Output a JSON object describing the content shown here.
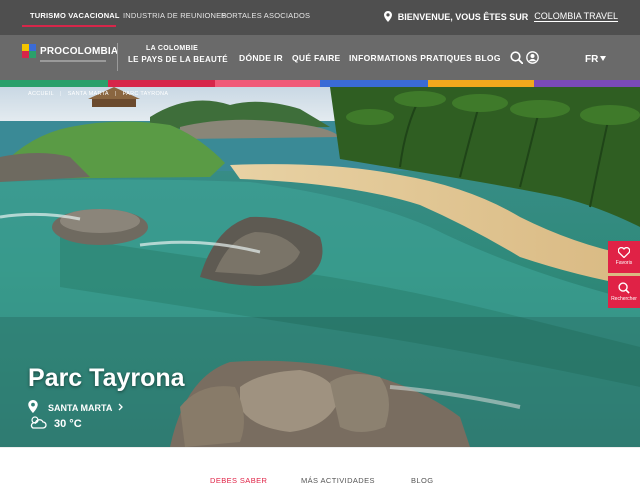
{
  "topbar": {
    "links": [
      {
        "label": "TURISMO VACACIONAL",
        "active": true
      },
      {
        "label": "INDUSTRIA DE REUNIONES",
        "active": false
      },
      {
        "label": "PORTALES ASOCIADOS",
        "active": false
      }
    ],
    "welcome_prefix": "BIENVENUE, VOUS ÊTES SUR",
    "welcome_site": "COLOMBIA TRAVEL"
  },
  "nav": {
    "logo_text": "PROCOLOMBIA",
    "brand_top": "LA COLOMBIE",
    "brand_bottom": "LE PAYS DE LA BEAUTÉ",
    "items": [
      "DÓNDE IR",
      "QUÉ FAIRE",
      "INFORMATIONS PRATIQUES",
      "BLOG"
    ],
    "language": "FR"
  },
  "colors": {
    "accent": "#e02246",
    "stripe": [
      "#2aa06b",
      "#d7264a",
      "#f05a78",
      "#3a6bd6",
      "#f2a81d",
      "#7a4ab8"
    ]
  },
  "breadcrumb": [
    "ACCUEIL",
    "SANTA MARTA",
    "PARC TAYRONA"
  ],
  "hero": {
    "title": "Parc Tayrona",
    "location": "SANTA MARTA",
    "temperature": "30 °C"
  },
  "side_buttons": [
    {
      "label": "Favoris",
      "icon": "heart-icon"
    },
    {
      "label": "Rechercher",
      "icon": "search-icon"
    }
  ],
  "tabs": [
    {
      "label": "DEBES SABER",
      "active": true
    },
    {
      "label": "MÁS ACTIVIDADES",
      "active": false
    },
    {
      "label": "BLOG",
      "active": false
    }
  ]
}
